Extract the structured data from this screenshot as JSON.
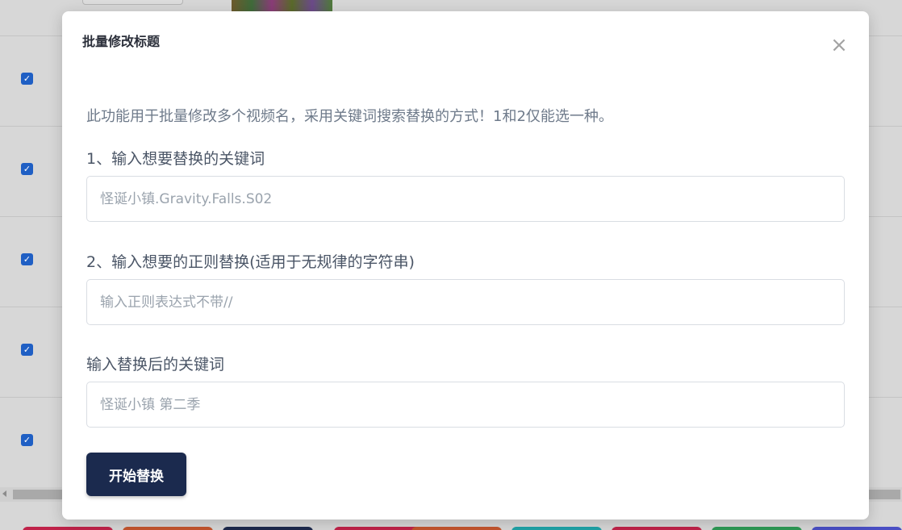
{
  "modal": {
    "title": "批量修改标题",
    "close_glyph": "×",
    "description": "此功能用于批量修改多个视频名，采用关键词搜索替换的方式！1和2仅能选一种。",
    "field_keyword": {
      "label": "1、输入想要替换的关键词",
      "placeholder": "怪诞小镇.Gravity.Falls.S02",
      "value": ""
    },
    "field_regex": {
      "label": "2、输入想要的正则替换(适用于无规律的字符串)",
      "placeholder": "输入正则表达式不带//",
      "value": ""
    },
    "field_replacement": {
      "label": "输入替换后的关键词",
      "placeholder": "怪诞小镇 第二季",
      "value": ""
    },
    "submit_label": "开始替换"
  },
  "background": {
    "row_checkbox_glyph": "✓",
    "checkbox_color": "#1f5fc4"
  },
  "colors": {
    "primary_button": "#1b2a4e",
    "overlay": "#d6d6d6"
  }
}
